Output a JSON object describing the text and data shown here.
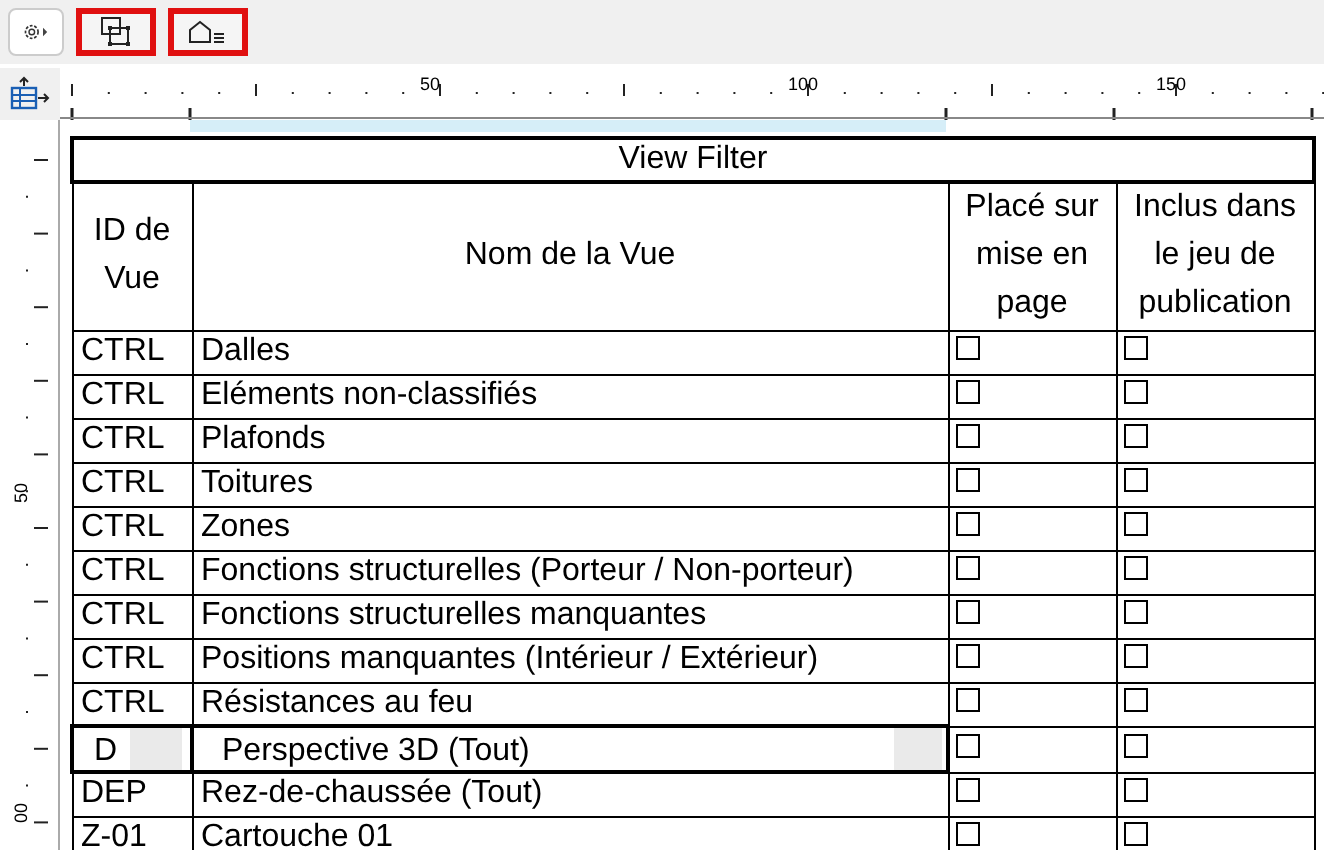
{
  "toolbar": {
    "buttons": [
      {
        "kind": "settings",
        "highlighted": false
      },
      {
        "kind": "select",
        "highlighted": true
      },
      {
        "kind": "house-list",
        "highlighted": true
      }
    ]
  },
  "ruler": {
    "top_labels": [
      "50",
      "100",
      "150"
    ],
    "left_labels": [
      "50",
      "00"
    ]
  },
  "table": {
    "title": "View Filter",
    "columns": [
      "ID de Vue",
      "Nom de la Vue",
      "Placé sur mise en page",
      "Inclus dans le jeu de publication"
    ],
    "rows": [
      {
        "id": "CTRL",
        "name": "Dalles",
        "placed": false,
        "included": false,
        "editing": false
      },
      {
        "id": "CTRL",
        "name": "Eléments non-classifiés",
        "placed": false,
        "included": false,
        "editing": false
      },
      {
        "id": "CTRL",
        "name": "Plafonds",
        "placed": false,
        "included": false,
        "editing": false
      },
      {
        "id": "CTRL",
        "name": "Toitures",
        "placed": false,
        "included": false,
        "editing": false
      },
      {
        "id": "CTRL",
        "name": "Zones",
        "placed": false,
        "included": false,
        "editing": false
      },
      {
        "id": "CTRL",
        "name": "Fonctions structurelles (Porteur / Non-porteur)",
        "placed": false,
        "included": false,
        "editing": false
      },
      {
        "id": "CTRL",
        "name": "Fonctions structurelles manquantes",
        "placed": false,
        "included": false,
        "editing": false
      },
      {
        "id": "CTRL",
        "name": "Positions manquantes (Intérieur / Extérieur)",
        "placed": false,
        "included": false,
        "editing": false
      },
      {
        "id": "CTRL",
        "name": "Résistances au feu",
        "placed": false,
        "included": false,
        "editing": false
      },
      {
        "id": "D",
        "name": "Perspective 3D (Tout)",
        "placed": false,
        "included": false,
        "editing": true
      },
      {
        "id": "DEP",
        "name": "Rez-de-chaussée (Tout)",
        "placed": false,
        "included": false,
        "editing": false
      },
      {
        "id": "Z-01",
        "name": "Cartouche 01",
        "placed": false,
        "included": false,
        "editing": false
      }
    ]
  }
}
